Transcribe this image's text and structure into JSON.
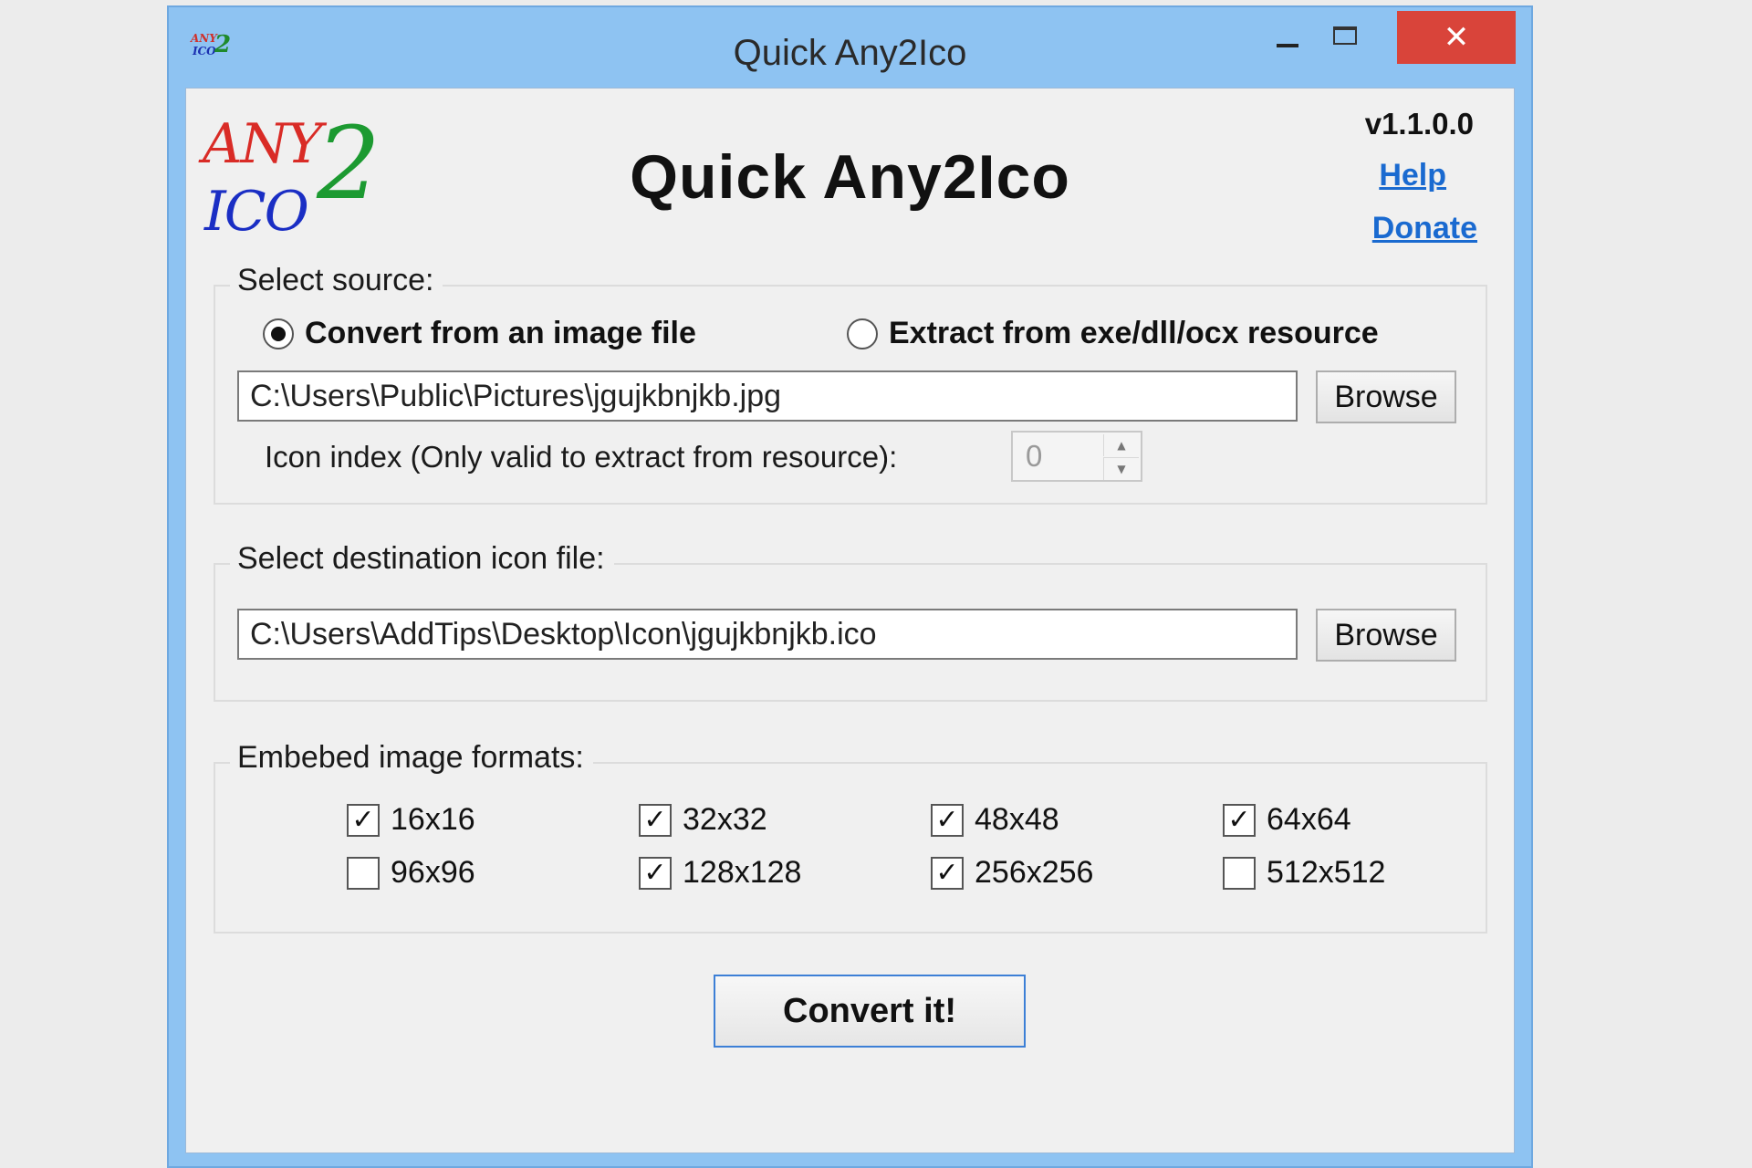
{
  "window": {
    "title": "Quick Any2Ico",
    "icon": "app-icon",
    "controls": {
      "minimize": "minimize-icon",
      "maximize": "maximize-icon",
      "close_glyph": "✕"
    }
  },
  "header": {
    "logo": {
      "line1": "ANY",
      "line2": "ICO",
      "digit": "2"
    },
    "title": "Quick Any2Ico",
    "version": "v1.1.0.0",
    "help_link": "Help",
    "donate_link": "Donate"
  },
  "source": {
    "legend": "Select source:",
    "options": [
      {
        "label": "Convert from an image file",
        "checked": true
      },
      {
        "label": "Extract from exe/dll/ocx resource",
        "checked": false
      }
    ],
    "path": "C:\\Users\\Public\\Pictures\\jgujkbnjkb.jpg",
    "browse_label": "Browse",
    "icon_index_label": "Icon index (Only valid to extract from resource):",
    "icon_index_value": "0"
  },
  "destination": {
    "legend": "Select destination icon file:",
    "path": "C:\\Users\\AddTips\\Desktop\\Icon\\jgujkbnjkb.ico",
    "browse_label": "Browse"
  },
  "formats": {
    "legend": "Embebed image formats:",
    "items": [
      {
        "label": "16x16",
        "checked": true
      },
      {
        "label": "32x32",
        "checked": true
      },
      {
        "label": "48x48",
        "checked": true
      },
      {
        "label": "64x64",
        "checked": true
      },
      {
        "label": "96x96",
        "checked": false
      },
      {
        "label": "128x128",
        "checked": true
      },
      {
        "label": "256x256",
        "checked": true
      },
      {
        "label": "512x512",
        "checked": false
      }
    ]
  },
  "actions": {
    "convert_label": "Convert it!"
  },
  "colors": {
    "window_frame": "#8ec3f2",
    "close_button": "#d9443a",
    "link": "#1a6ad0",
    "logo_red": "#d92b26",
    "logo_blue": "#1a2ec4",
    "logo_green": "#1c9a31"
  }
}
